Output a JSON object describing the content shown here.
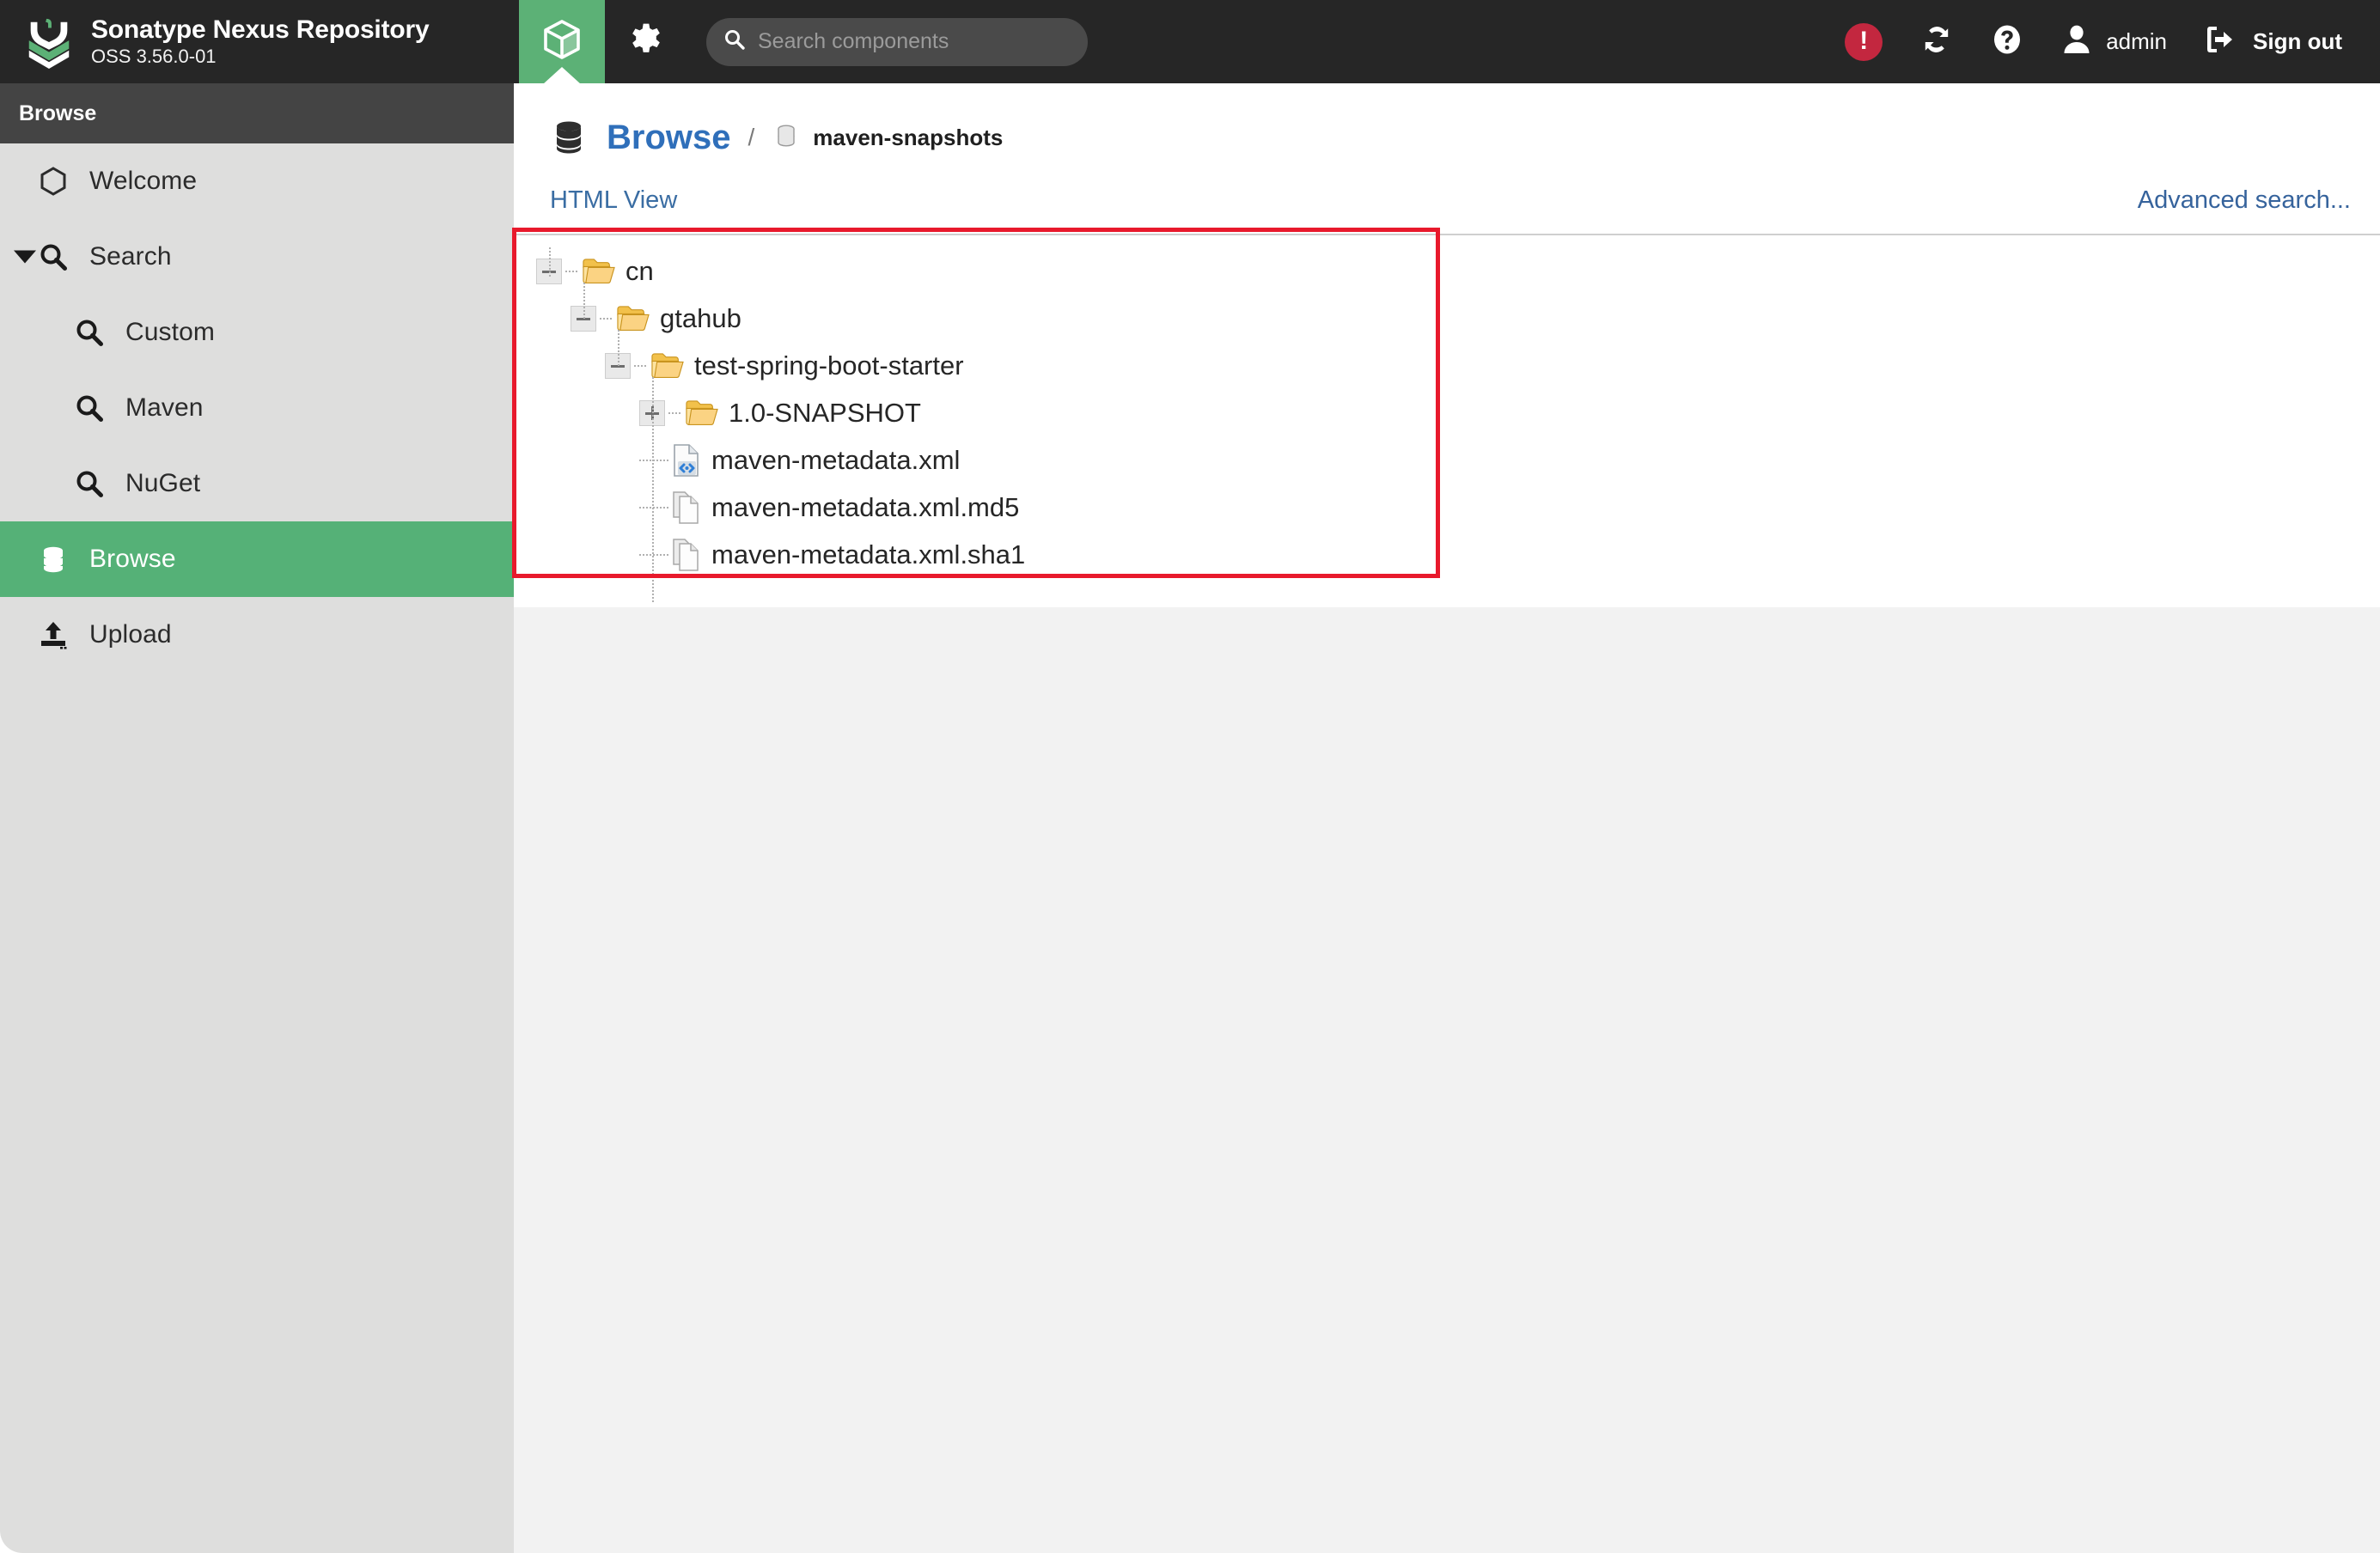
{
  "header": {
    "brand_title": "Sonatype Nexus Repository",
    "brand_subtitle": "OSS 3.56.0-01",
    "logo_icon": "nexus-chevrons-logo",
    "browse_tab_icon": "cube-icon",
    "settings_tab_icon": "gear-icon",
    "search": {
      "icon": "search-icon",
      "placeholder": "Search components",
      "value": ""
    },
    "alert": {
      "icon": "alert-exclamation-icon",
      "symbol": "!"
    },
    "refresh": {
      "icon": "refresh-sync-icon"
    },
    "help": {
      "icon": "help-question-icon"
    },
    "user": {
      "icon": "user-avatar-icon",
      "name": "admin"
    },
    "signout": {
      "icon": "sign-out-icon",
      "label": "Sign out"
    }
  },
  "sidebar": {
    "title": "Browse",
    "items": [
      {
        "label": "Welcome",
        "icon": "hexagon-icon",
        "indent": 0,
        "active": false,
        "caret": false
      },
      {
        "label": "Search",
        "icon": "search-icon",
        "indent": 0,
        "active": false,
        "caret": true
      },
      {
        "label": "Custom",
        "icon": "search-icon",
        "indent": 1,
        "active": false,
        "caret": false
      },
      {
        "label": "Maven",
        "icon": "search-icon",
        "indent": 1,
        "active": false,
        "caret": false
      },
      {
        "label": "NuGet",
        "icon": "search-icon",
        "indent": 1,
        "active": false,
        "caret": false
      },
      {
        "label": "Browse",
        "icon": "database-icon",
        "indent": 0,
        "active": true,
        "caret": false
      },
      {
        "label": "Upload",
        "icon": "upload-icon",
        "indent": 0,
        "active": false,
        "caret": false
      }
    ]
  },
  "main": {
    "breadcrumb": {
      "icon": "database-icon",
      "root_label": "Browse",
      "separator": "/",
      "repo_icon": "repository-icon",
      "repo_label": "maven-snapshots"
    },
    "html_view_label": "HTML View",
    "advanced_search_label": "Advanced search...",
    "tree": [
      {
        "label": "cn",
        "depth": 0,
        "type": "folder",
        "toggle": "minus",
        "icon": "folder-open-icon"
      },
      {
        "label": "gtahub",
        "depth": 1,
        "type": "folder",
        "toggle": "minus",
        "icon": "folder-open-icon"
      },
      {
        "label": "test-spring-boot-starter",
        "depth": 2,
        "type": "folder",
        "toggle": "minus",
        "icon": "folder-open-icon"
      },
      {
        "label": "1.0-SNAPSHOT",
        "depth": 3,
        "type": "folder",
        "toggle": "plus",
        "icon": "folder-open-icon"
      },
      {
        "label": "maven-metadata.xml",
        "depth": 3,
        "type": "file",
        "toggle": "none",
        "icon": "xml-file-icon"
      },
      {
        "label": "maven-metadata.xml.md5",
        "depth": 3,
        "type": "file",
        "toggle": "none",
        "icon": "checksum-file-icon"
      },
      {
        "label": "maven-metadata.xml.sha1",
        "depth": 3,
        "type": "file",
        "toggle": "none",
        "icon": "checksum-file-icon"
      }
    ]
  },
  "annotation": {
    "type": "highlight-rectangle",
    "color": "#e8192c"
  },
  "colors": {
    "header_bg": "#262626",
    "accent_green": "#5cb176",
    "sidebar_bg": "#dededd",
    "sidebar_header_bg": "#444444",
    "content_bg": "#f2f2f2",
    "link_blue": "#3a6da3",
    "breadcrumb_blue": "#2f6fba",
    "alert_red": "#c3273f",
    "annotation_red": "#e8192c"
  }
}
